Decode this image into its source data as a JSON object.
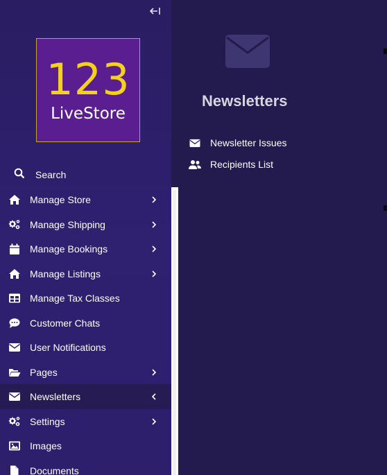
{
  "sidebar": {
    "collapse_icon": "collapse-left-icon",
    "logo": {
      "number": "123",
      "word": "LiveStore",
      "bg": "#5a1e90",
      "number_color": "#f4d11b",
      "border": "#c7a13b"
    },
    "search_label": "Search",
    "items": [
      {
        "label": "Manage Store",
        "icon": "home-icon",
        "chevron": "right"
      },
      {
        "label": "Manage Shipping",
        "icon": "cogs-icon",
        "chevron": "right"
      },
      {
        "label": "Manage Bookings",
        "icon": "calendar-icon",
        "chevron": "right"
      },
      {
        "label": "Manage Listings",
        "icon": "home-icon",
        "chevron": "right"
      },
      {
        "label": "Manage Tax Classes",
        "icon": "table-icon",
        "chevron": ""
      },
      {
        "label": "Customer Chats",
        "icon": "chat-icon",
        "chevron": ""
      },
      {
        "label": "User Notifications",
        "icon": "envelope-icon",
        "chevron": ""
      },
      {
        "label": "Pages",
        "icon": "folder-open-icon",
        "chevron": "right"
      },
      {
        "label": "Newsletters",
        "icon": "envelope-icon",
        "chevron": "left",
        "active": true
      },
      {
        "label": "Settings",
        "icon": "cogs-icon",
        "chevron": "right"
      },
      {
        "label": "Images",
        "icon": "image-icon",
        "chevron": ""
      },
      {
        "label": "Documents",
        "icon": "document-icon",
        "chevron": ""
      }
    ]
  },
  "main": {
    "icon": "envelope-icon",
    "title": "Newsletters",
    "items": [
      {
        "label": "Newsletter Issues",
        "icon": "envelope-icon"
      },
      {
        "label": "Recipients List",
        "icon": "users-icon"
      }
    ]
  },
  "colors": {
    "sidebar_bg": "#2d1f6c",
    "main_bg": "#231a4d",
    "active_bg": "#261b52",
    "title": "#d7d5e0"
  }
}
